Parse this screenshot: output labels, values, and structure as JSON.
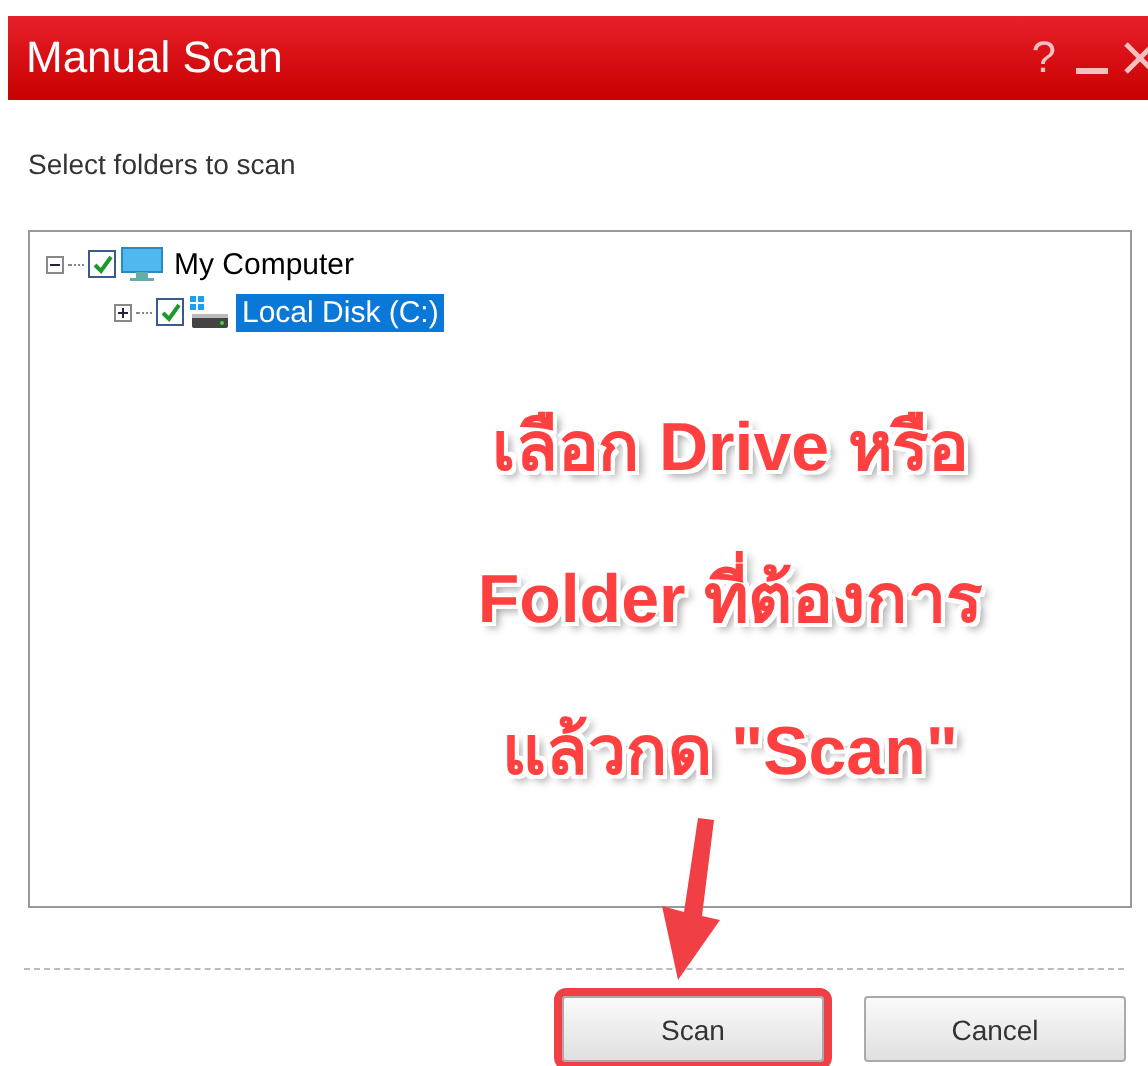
{
  "window": {
    "title": "Manual Scan",
    "help": "?"
  },
  "instruction": "Select folders to scan",
  "tree": [
    {
      "label": "My Computer",
      "kind": "computer",
      "checked": true,
      "expanded": true,
      "selected": false,
      "children": [
        {
          "label": "Local Disk (C:)",
          "kind": "disk",
          "checked": true,
          "expanded": false,
          "selected": true
        }
      ]
    }
  ],
  "annotation": {
    "lines": [
      "เลือก Drive หรือ",
      "Folder ที่ต้องการ",
      "แล้วกด \"Scan\""
    ]
  },
  "buttons": [
    {
      "label": "Scan",
      "highlighted": true
    },
    {
      "label": "Cancel",
      "highlighted": false
    }
  ]
}
